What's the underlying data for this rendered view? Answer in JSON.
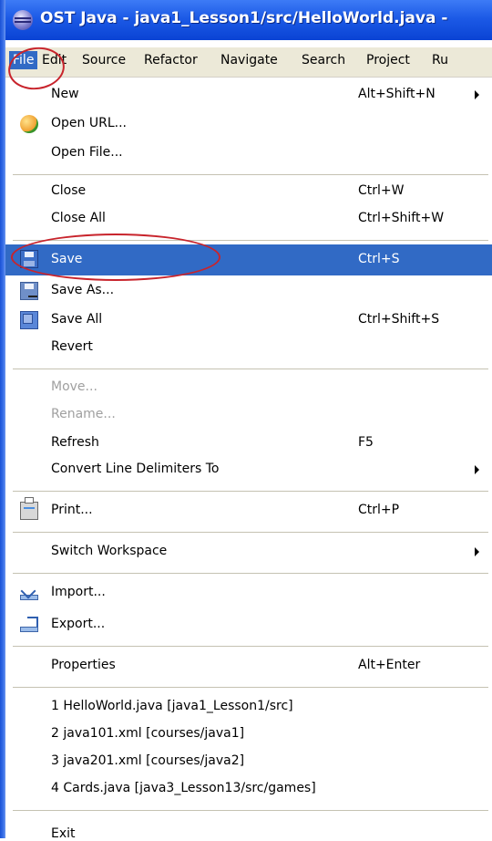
{
  "window": {
    "title": "OST Java - java1_Lesson1/src/HelloWorld.java -"
  },
  "menu_bar": {
    "items": [
      "File",
      "Edit",
      "Source",
      "Refactor",
      "Navigate",
      "Search",
      "Project",
      "Ru"
    ]
  },
  "file_menu": {
    "new": {
      "label": "New",
      "shortcut": "Alt+Shift+N"
    },
    "open_url": {
      "label": "Open URL..."
    },
    "open_file": {
      "label": "Open File..."
    },
    "close": {
      "label": "Close",
      "shortcut": "Ctrl+W"
    },
    "close_all": {
      "label": "Close All",
      "shortcut": "Ctrl+Shift+W"
    },
    "save": {
      "label": "Save",
      "shortcut": "Ctrl+S"
    },
    "save_as": {
      "label": "Save As..."
    },
    "save_all": {
      "label": "Save All",
      "shortcut": "Ctrl+Shift+S"
    },
    "revert": {
      "label": "Revert"
    },
    "move": {
      "label": "Move..."
    },
    "rename": {
      "label": "Rename..."
    },
    "refresh": {
      "label": "Refresh",
      "shortcut": "F5"
    },
    "convert": {
      "label": "Convert Line Delimiters To"
    },
    "print": {
      "label": "Print...",
      "shortcut": "Ctrl+P"
    },
    "switch_workspace": {
      "label": "Switch Workspace"
    },
    "import": {
      "label": "Import..."
    },
    "export": {
      "label": "Export..."
    },
    "properties": {
      "label": "Properties",
      "shortcut": "Alt+Enter"
    },
    "recent": [
      "1 HelloWorld.java  [java1_Lesson1/src]",
      "2 java101.xml  [courses/java1]",
      "3 java201.xml  [courses/java2]",
      "4 Cards.java  [java3_Lesson13/src/games]"
    ],
    "exit": {
      "label": "Exit"
    }
  },
  "colors": {
    "title_bar": "#1c5ae6",
    "highlight": "#316ac5",
    "annotation_circle": "#c8242c",
    "disabled_text": "#a0a0a0"
  }
}
